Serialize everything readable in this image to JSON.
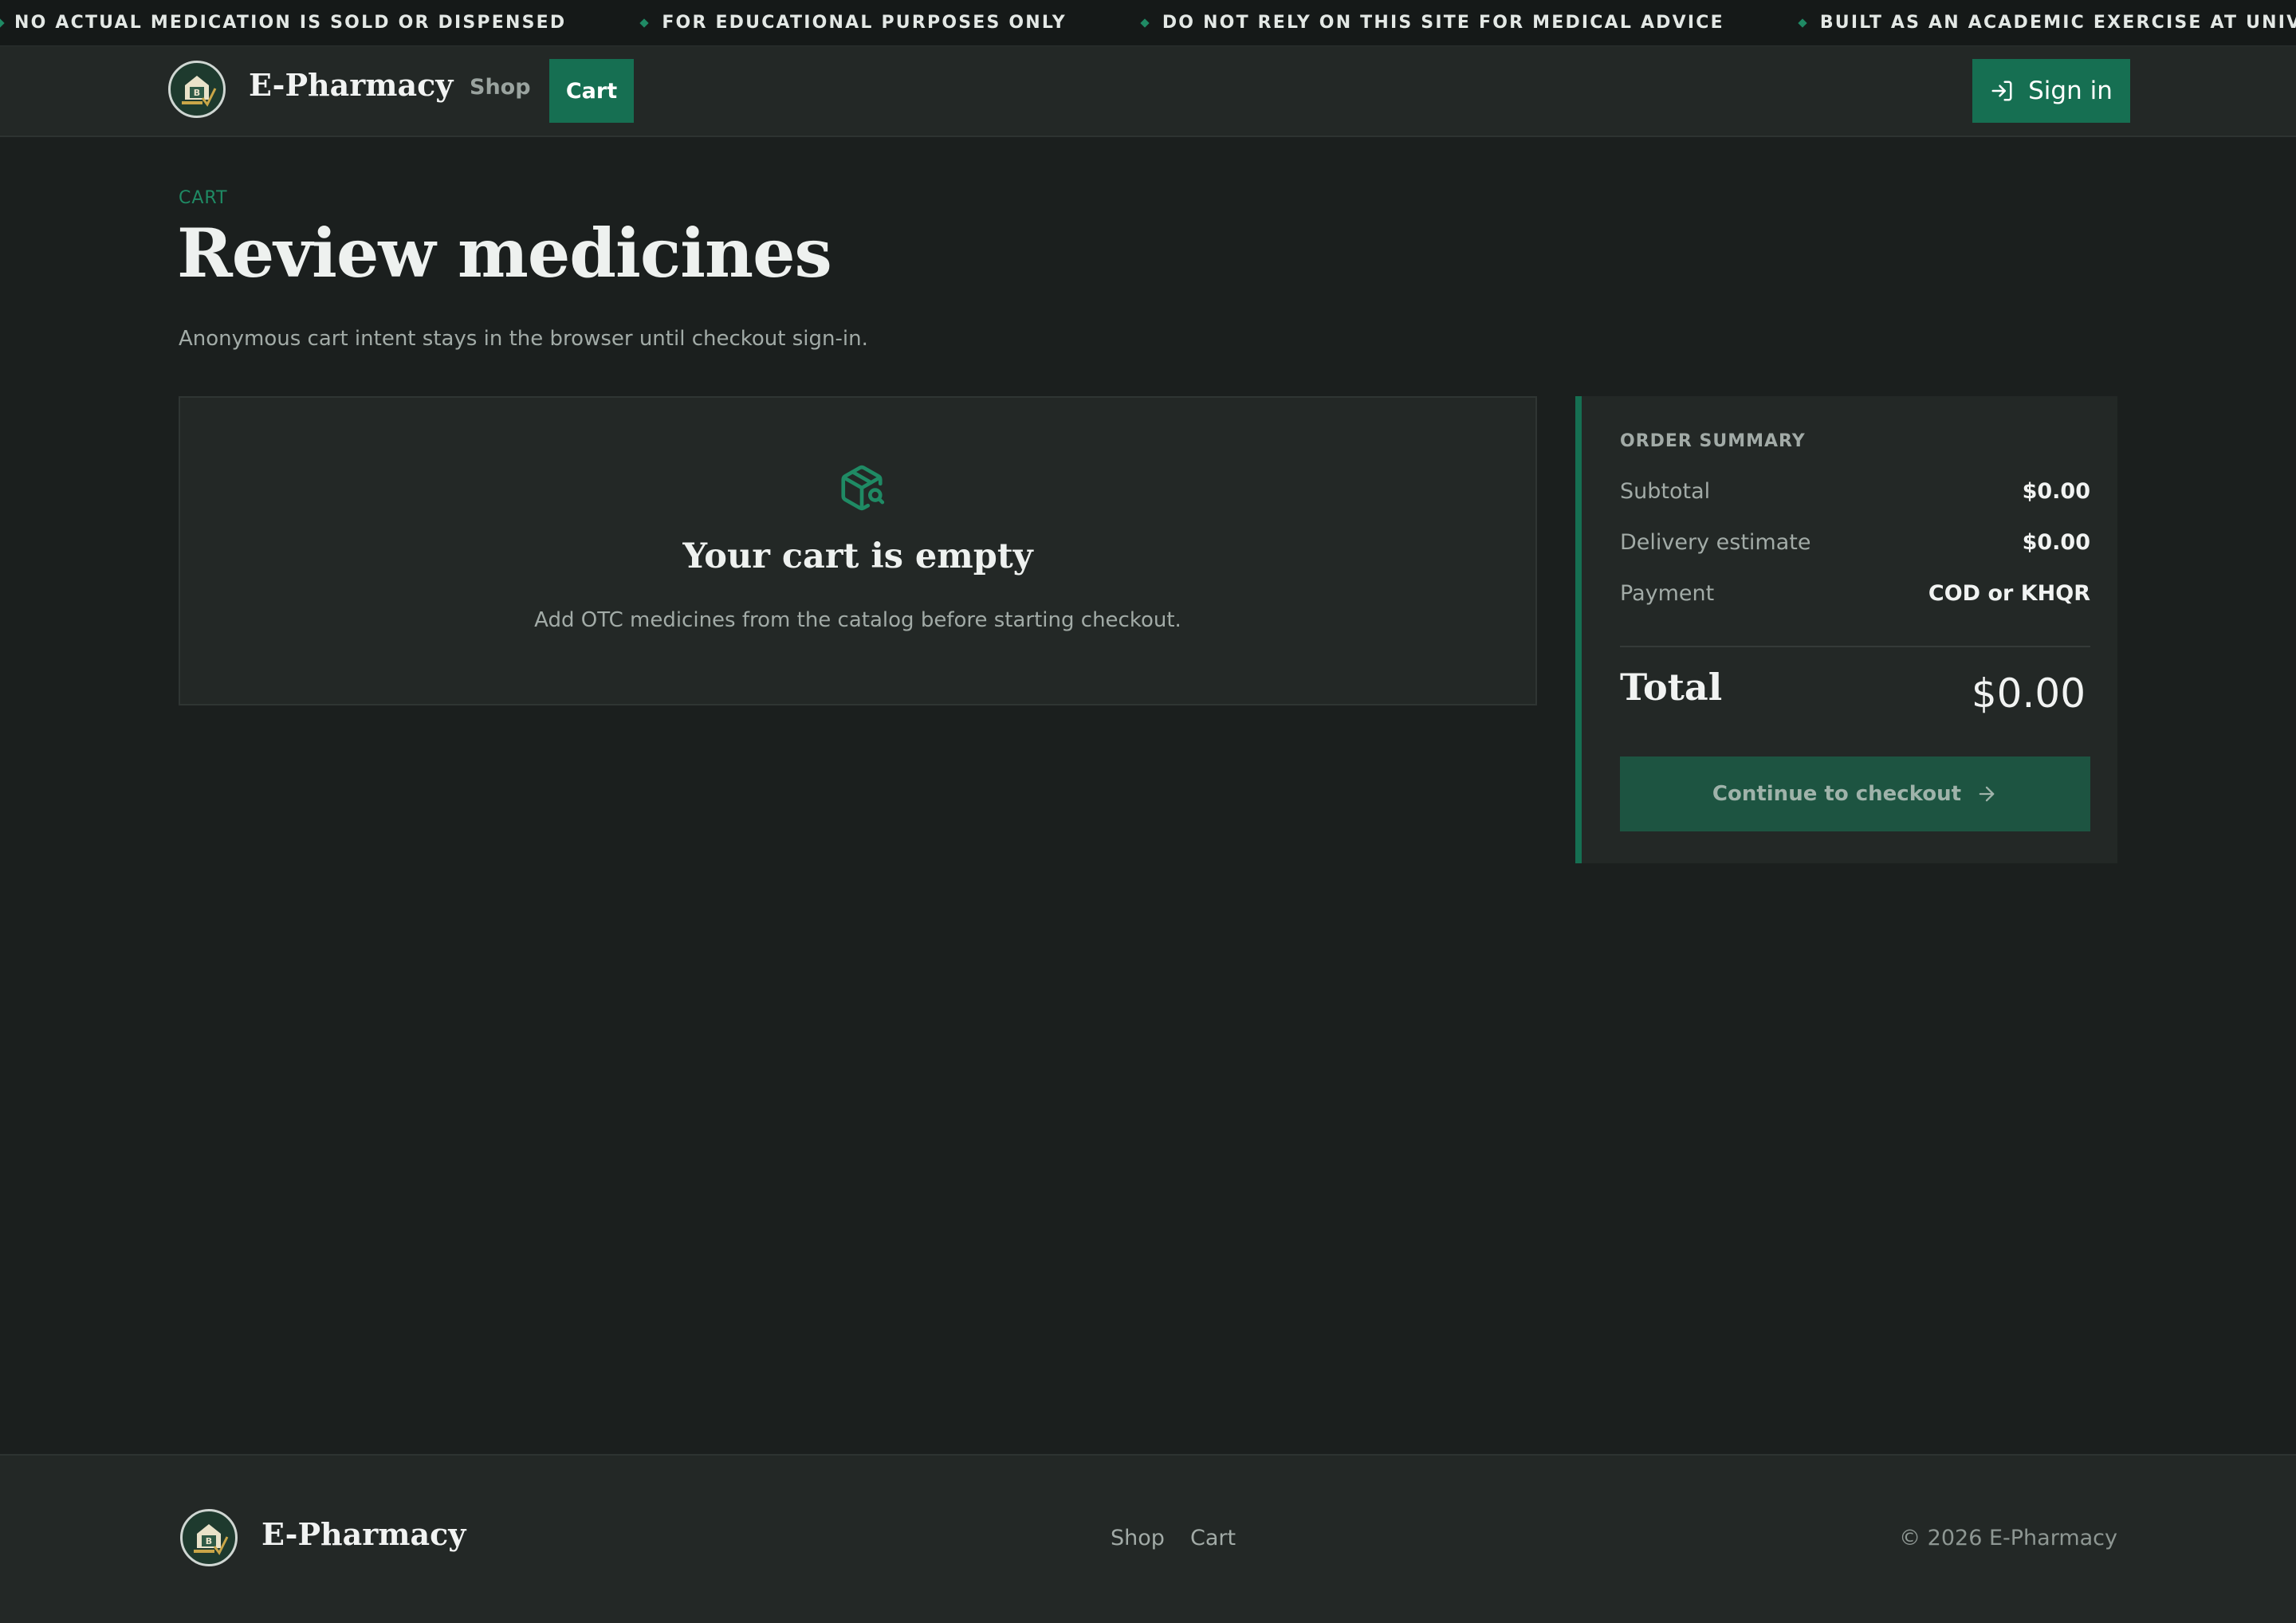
{
  "ticker": {
    "items": [
      "NO ACTUAL MEDICATION IS SOLD OR DISPENSED",
      "FOR EDUCATIONAL PURPOSES ONLY",
      "DO NOT RELY ON THIS SITE FOR MEDICAL ADVICE",
      "BUILT AS AN ACADEMIC EXERCISE AT UNIVERSI"
    ]
  },
  "header": {
    "brand": "E-Pharmacy",
    "nav": {
      "shop": "Shop",
      "cart": "Cart"
    },
    "signin_label": "Sign in"
  },
  "page": {
    "eyebrow": "CART",
    "title": "Review medicines",
    "subtitle": "Anonymous cart intent stays in the browser until checkout sign-in."
  },
  "cart": {
    "empty_title": "Your cart is empty",
    "empty_message": "Add OTC medicines from the catalog before starting checkout."
  },
  "summary": {
    "heading": "ORDER SUMMARY",
    "rows": [
      {
        "label": "Subtotal",
        "value": "$0.00"
      },
      {
        "label": "Delivery estimate",
        "value": "$0.00"
      },
      {
        "label": "Payment",
        "value": "COD or KHQR"
      }
    ],
    "total_label": "Total",
    "total_value": "$0.00",
    "checkout_label": "Continue to checkout"
  },
  "footer": {
    "brand": "E-Pharmacy",
    "links": {
      "shop": "Shop",
      "cart": "Cart"
    },
    "copyright": "© 2026 E-Pharmacy"
  },
  "colors": {
    "background": "#1b1f1e",
    "panel": "#232826",
    "accent": "#166f52",
    "accent_muted": "#1d5441"
  }
}
